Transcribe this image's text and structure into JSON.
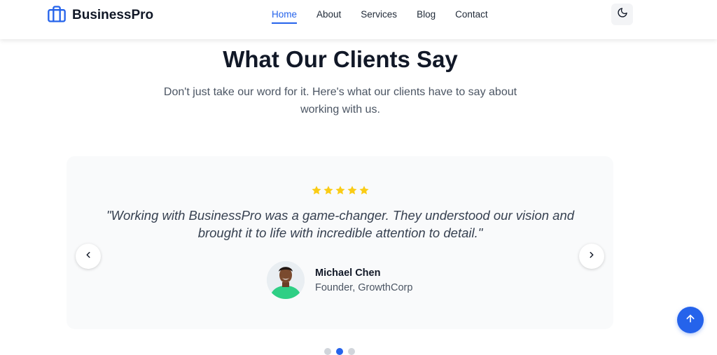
{
  "brand": {
    "name": "BusinessPro",
    "icon": "briefcase-icon",
    "color": "#2563eb"
  },
  "nav": {
    "items": [
      {
        "label": "Home",
        "active": true
      },
      {
        "label": "About",
        "active": false
      },
      {
        "label": "Services",
        "active": false
      },
      {
        "label": "Blog",
        "active": false
      },
      {
        "label": "Contact",
        "active": false
      }
    ],
    "theme_toggle_icon": "moon-icon"
  },
  "section": {
    "title": "What Our Clients Say",
    "subtitle": "Don't just take our word for it. Here's what our clients have to say about working with us."
  },
  "testimonial": {
    "rating": 5,
    "star_color": "#facc15",
    "quote": "\"Working with BusinessPro was a game-changer. They understood our vision and brought it to life with incredible attention to detail.\"",
    "author_name": "Michael Chen",
    "author_role": "Founder, GrowthCorp"
  },
  "carousel": {
    "prev_icon": "chevron-left-icon",
    "next_icon": "chevron-right-icon",
    "slide_count": 3,
    "active_index": 1
  },
  "scroll_top_icon": "arrow-up-icon",
  "colors": {
    "accent": "#2563eb",
    "card_bg": "#f9fafb",
    "text_dark": "#111827",
    "text_muted": "#4b5563"
  }
}
